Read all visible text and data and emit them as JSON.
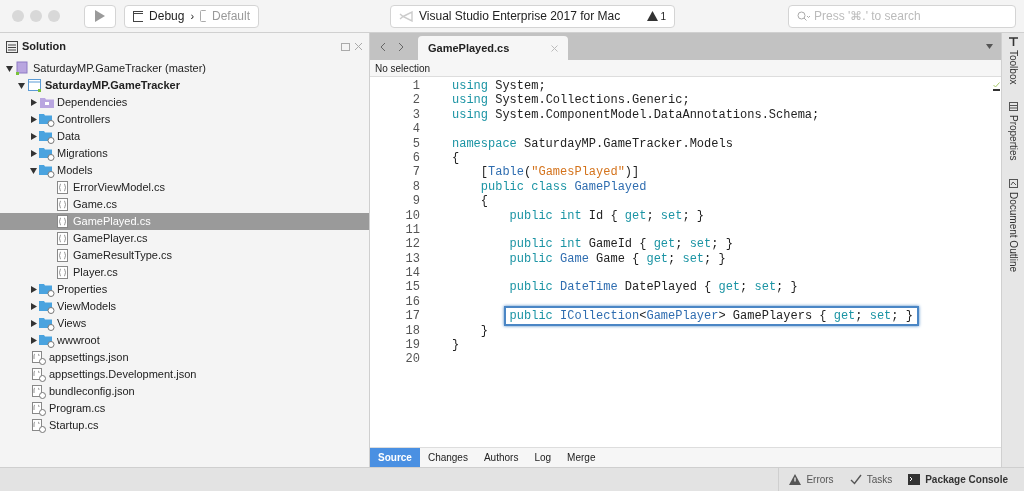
{
  "toolbar": {
    "config": "Debug",
    "separator": "›",
    "device": "Default",
    "status": "Visual Studio Enterprise 2017 for Mac",
    "warnings": "1",
    "search": {
      "placeholder": "Press '⌘.' to search"
    }
  },
  "solution_pad": {
    "title": "Solution",
    "tree": [
      {
        "label": "SaturdayMP.GameTracker (master)",
        "kind": "solution",
        "expanded": true,
        "selected": false,
        "children": [
          {
            "label": "SaturdayMP.GameTracker",
            "kind": "project",
            "expanded": true,
            "bold": true,
            "selected": false,
            "children": [
              {
                "label": "Dependencies",
                "kind": "deps",
                "expanded": false,
                "selected": false
              },
              {
                "label": "Controllers",
                "kind": "folder",
                "expanded": false,
                "selected": false
              },
              {
                "label": "Data",
                "kind": "folder",
                "expanded": false,
                "selected": false
              },
              {
                "label": "Migrations",
                "kind": "folder",
                "expanded": false,
                "selected": false
              },
              {
                "label": "Models",
                "kind": "folder",
                "expanded": true,
                "selected": false,
                "children": [
                  {
                    "label": "ErrorViewModel.cs",
                    "kind": "code",
                    "selected": false
                  },
                  {
                    "label": "Game.cs",
                    "kind": "code",
                    "selected": false
                  },
                  {
                    "label": "GamePlayed.cs",
                    "kind": "code",
                    "selected": true
                  },
                  {
                    "label": "GamePlayer.cs",
                    "kind": "code",
                    "selected": false
                  },
                  {
                    "label": "GameResultType.cs",
                    "kind": "code",
                    "selected": false
                  },
                  {
                    "label": "Player.cs",
                    "kind": "code",
                    "selected": false
                  }
                ]
              },
              {
                "label": "Properties",
                "kind": "folder",
                "expanded": false,
                "selected": false
              },
              {
                "label": "ViewModels",
                "kind": "folder",
                "expanded": false,
                "selected": false
              },
              {
                "label": "Views",
                "kind": "folder",
                "expanded": false,
                "selected": false
              },
              {
                "label": "wwwroot",
                "kind": "folder",
                "expanded": false,
                "selected": false
              },
              {
                "label": "appsettings.json",
                "kind": "file",
                "selected": false
              },
              {
                "label": "appsettings.Development.json",
                "kind": "file",
                "selected": false
              },
              {
                "label": "bundleconfig.json",
                "kind": "file",
                "selected": false
              },
              {
                "label": "Program.cs",
                "kind": "file",
                "selected": false
              },
              {
                "label": "Startup.cs",
                "kind": "file",
                "selected": false
              }
            ]
          }
        ]
      }
    ]
  },
  "editor": {
    "tab": "GamePlayed.cs",
    "breadcrumb": "No selection",
    "lines": [
      {
        "number": "1",
        "tokens": [
          {
            "kind": "keyword",
            "text": "using"
          },
          {
            "kind": "plain",
            "text": " System;"
          }
        ]
      },
      {
        "number": "2",
        "tokens": [
          {
            "kind": "keyword",
            "text": "using"
          },
          {
            "kind": "plain",
            "text": " System.Collections.Generic;"
          }
        ]
      },
      {
        "number": "3",
        "tokens": [
          {
            "kind": "keyword",
            "text": "using"
          },
          {
            "kind": "plain",
            "text": " System.ComponentModel.DataAnnotations.Schema;"
          }
        ]
      },
      {
        "number": "4"
      },
      {
        "number": "5",
        "tokens": [
          {
            "kind": "keyword",
            "text": "namespace"
          },
          {
            "kind": "plain",
            "text": " SaturdayMP.GameTracker.Models"
          }
        ]
      },
      {
        "number": "6",
        "tokens": [
          {
            "kind": "plain",
            "text": "{"
          }
        ]
      },
      {
        "number": "7",
        "tokens": [
          {
            "kind": "plain",
            "text": "    ["
          },
          {
            "kind": "type",
            "text": "Table"
          },
          {
            "kind": "plain",
            "text": "("
          },
          {
            "kind": "string",
            "text": "\"GamesPlayed\""
          },
          {
            "kind": "plain",
            "text": ")]"
          }
        ]
      },
      {
        "number": "8",
        "tokens": [
          {
            "kind": "keyword",
            "text": "    public class"
          },
          {
            "kind": "type",
            "text": " GamePlayed"
          }
        ]
      },
      {
        "number": "9",
        "tokens": [
          {
            "kind": "plain",
            "text": "    {"
          }
        ]
      },
      {
        "number": "10",
        "tokens": [
          {
            "kind": "keyword",
            "text": "        public int"
          },
          {
            "kind": "plain",
            "text": " Id { "
          },
          {
            "kind": "keyword",
            "text": "get"
          },
          {
            "kind": "plain",
            "text": "; "
          },
          {
            "kind": "keyword",
            "text": "set"
          },
          {
            "kind": "plain",
            "text": "; }"
          }
        ]
      },
      {
        "number": "11"
      },
      {
        "number": "12",
        "tokens": [
          {
            "kind": "keyword",
            "text": "        public int"
          },
          {
            "kind": "plain",
            "text": " GameId { "
          },
          {
            "kind": "keyword",
            "text": "get"
          },
          {
            "kind": "plain",
            "text": "; "
          },
          {
            "kind": "keyword",
            "text": "set"
          },
          {
            "kind": "plain",
            "text": "; }"
          }
        ]
      },
      {
        "number": "13",
        "tokens": [
          {
            "kind": "keyword",
            "text": "        public"
          },
          {
            "kind": "type",
            "text": " Game"
          },
          {
            "kind": "plain",
            "text": " Game { "
          },
          {
            "kind": "keyword",
            "text": "get"
          },
          {
            "kind": "plain",
            "text": "; "
          },
          {
            "kind": "keyword",
            "text": "set"
          },
          {
            "kind": "plain",
            "text": "; }"
          }
        ]
      },
      {
        "number": "14"
      },
      {
        "number": "15",
        "tokens": [
          {
            "kind": "keyword",
            "text": "        public"
          },
          {
            "kind": "type",
            "text": " DateTime"
          },
          {
            "kind": "plain",
            "text": " DatePlayed { "
          },
          {
            "kind": "keyword",
            "text": "get"
          },
          {
            "kind": "plain",
            "text": "; "
          },
          {
            "kind": "keyword",
            "text": "set"
          },
          {
            "kind": "plain",
            "text": "; }"
          }
        ]
      },
      {
        "number": "16"
      },
      {
        "number": "17",
        "highlighted": true,
        "tokens": [
          {
            "kind": "keyword",
            "text": "        public"
          },
          {
            "kind": "type",
            "text": " ICollection"
          },
          {
            "kind": "plain",
            "text": "<"
          },
          {
            "kind": "type",
            "text": "GamePlayer"
          },
          {
            "kind": "plain",
            "text": "> GamePlayers { "
          },
          {
            "kind": "keyword",
            "text": "get"
          },
          {
            "kind": "plain",
            "text": "; "
          },
          {
            "kind": "keyword",
            "text": "set"
          },
          {
            "kind": "plain",
            "text": "; }"
          }
        ]
      },
      {
        "number": "18",
        "tokens": [
          {
            "kind": "plain",
            "text": "    }"
          }
        ]
      },
      {
        "number": "19",
        "tokens": [
          {
            "kind": "plain",
            "text": "}"
          }
        ]
      },
      {
        "number": "20"
      }
    ],
    "bottom_tabs": [
      {
        "label": "Source",
        "selected": true
      },
      {
        "label": "Changes",
        "selected": false
      },
      {
        "label": "Authors",
        "selected": false
      },
      {
        "label": "Log",
        "selected": false
      },
      {
        "label": "Merge",
        "selected": false
      }
    ]
  },
  "side_pads": [
    {
      "label": "Toolbox",
      "kind": "toolbox"
    },
    {
      "label": "Properties",
      "kind": "properties"
    },
    {
      "label": "Document Outline",
      "kind": "outline"
    }
  ],
  "status_bar": [
    {
      "label": "Errors",
      "kind": "errors"
    },
    {
      "label": "Tasks",
      "kind": "tasks"
    },
    {
      "label": "Package Console",
      "kind": "console"
    }
  ]
}
